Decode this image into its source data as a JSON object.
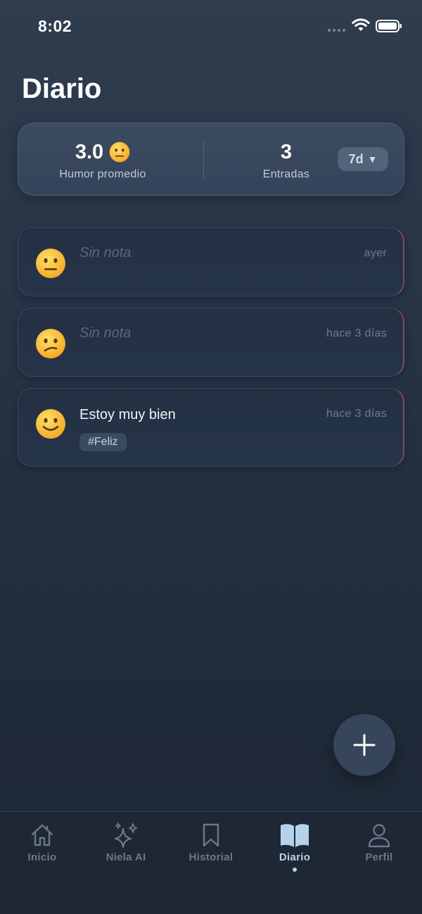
{
  "status": {
    "time": "8:02"
  },
  "page": {
    "title": "Diario"
  },
  "stats": {
    "mood_value": "3.0",
    "mood_label": "Humor promedio",
    "count_value": "3",
    "count_label": "Entradas",
    "range": "7d",
    "range_caret": "▼"
  },
  "entries": [
    {
      "emoji": "neutral-face",
      "note": "Sin nota",
      "date": "ayer",
      "tags": []
    },
    {
      "emoji": "confused-face",
      "note": "Sin nota",
      "date": "hace 3 días",
      "tags": []
    },
    {
      "emoji": "slightly-smiling-face",
      "note": "Estoy muy bien",
      "date": "hace 3 días",
      "tags": [
        "#Feliz"
      ]
    }
  ],
  "tabs": [
    {
      "label": "Inicio",
      "icon": "home-icon",
      "active": false
    },
    {
      "label": "Niela AI",
      "icon": "sparkles-icon",
      "active": false
    },
    {
      "label": "Historial",
      "icon": "bookmark-icon",
      "active": false
    },
    {
      "label": "Diario",
      "icon": "book-icon",
      "active": true
    },
    {
      "label": "Perfil",
      "icon": "person-icon",
      "active": false
    }
  ],
  "colors": {
    "accent": "#b5d2ea",
    "inactive": "#6c7788",
    "card_edge": "#8a4656"
  }
}
